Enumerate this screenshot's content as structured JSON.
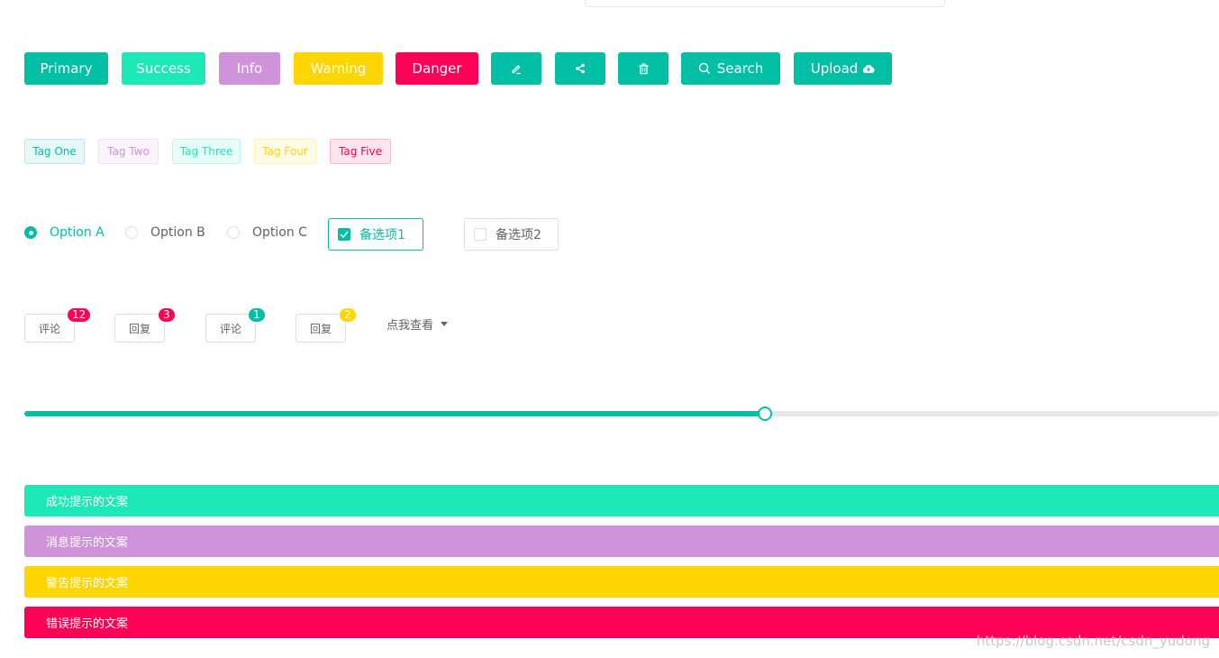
{
  "colors": {
    "primary": "#00bfa5",
    "success": "#1de9b6",
    "info": "#ce93d8",
    "warning": "#ffd600",
    "danger": "#ff0057",
    "text": "#606266",
    "border": "#dcdfe6",
    "runway": "#e4e7ed"
  },
  "buttons": {
    "primary": "Primary",
    "success": "Success",
    "info": "Info",
    "warning": "Warning",
    "danger": "Danger",
    "edit_icon": "edit-icon",
    "share_icon": "share-icon",
    "delete_icon": "delete-icon",
    "search": "Search",
    "search_icon": "search-icon",
    "upload": "Upload",
    "upload_icon": "cloud-upload-icon"
  },
  "tags": [
    "Tag One",
    "Tag Two",
    "Tag Three",
    "Tag Four",
    "Tag Five"
  ],
  "radios": {
    "options": [
      "Option A",
      "Option B",
      "Option C"
    ],
    "selected": "Option A"
  },
  "checkboxes": [
    {
      "label": "备选项1",
      "checked": true
    },
    {
      "label": "备选项2",
      "checked": false
    }
  ],
  "badges": [
    {
      "label": "评论",
      "count": "12"
    },
    {
      "label": "回复",
      "count": "3"
    },
    {
      "label": "评论",
      "count": "1"
    },
    {
      "label": "回复",
      "count": "2"
    }
  ],
  "dropdown": {
    "label": "点我查看"
  },
  "slider": {
    "value_fraction": 0.62
  },
  "alerts": {
    "success": "成功提示的文案",
    "info": "消息提示的文案",
    "warning": "警告提示的文案",
    "error": "错误提示的文案"
  },
  "watermark": "https://blog.csdn.net/csdn_yudong"
}
